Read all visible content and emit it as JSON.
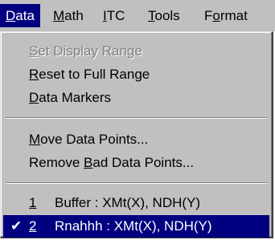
{
  "menubar": {
    "items": [
      {
        "mnemonic": "D",
        "rest": "ata"
      },
      {
        "mnemonic": "M",
        "rest": "ath"
      },
      {
        "mnemonic": "I",
        "rest": "TC"
      },
      {
        "mnemonic": "T",
        "rest": "ools"
      },
      {
        "pre": "F",
        "mnemonic": "o",
        "rest": "rmat"
      }
    ]
  },
  "dropdown": {
    "set_display_range": {
      "mnemonic": "S",
      "rest": "et Display Range"
    },
    "reset_full_range": {
      "mnemonic": "R",
      "rest": "eset to Full Range"
    },
    "data_markers": {
      "mnemonic": "D",
      "rest": "ata Markers"
    },
    "move_points": {
      "mnemonic": "M",
      "rest": "ove Data Points..."
    },
    "remove_bad": {
      "pre": "Remove ",
      "mnemonic": "B",
      "rest": "ad Data Points..."
    },
    "recent": [
      {
        "num": "1",
        "label": "Buffer : XMt(X), NDH(Y)"
      },
      {
        "num": "2",
        "label": "Rnahhh : XMt(X), NDH(Y)"
      }
    ],
    "check_glyph": "✔"
  }
}
